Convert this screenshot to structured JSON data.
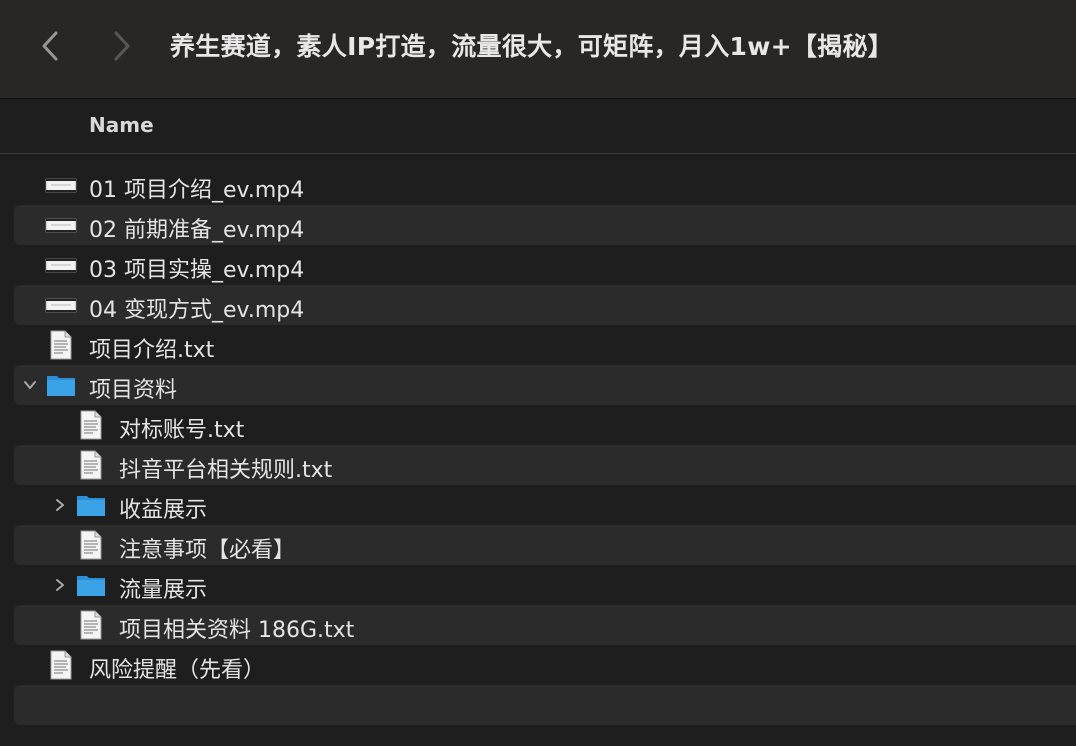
{
  "window": {
    "title": "养生赛道，素人IP打造，流量很大，可矩阵，月入1w+【揭秘】"
  },
  "header": {
    "name_column": "Name"
  },
  "files": [
    {
      "label": "01 项目介绍_ev.mp4",
      "type": "video",
      "depth": 0
    },
    {
      "label": "02 前期准备_ev.mp4",
      "type": "video",
      "depth": 0
    },
    {
      "label": "03 项目实操_ev.mp4",
      "type": "video",
      "depth": 0
    },
    {
      "label": "04 变现方式_ev.mp4",
      "type": "video",
      "depth": 0
    },
    {
      "label": "项目介绍.txt",
      "type": "text",
      "depth": 0
    },
    {
      "label": "项目资料",
      "type": "folder",
      "depth": 0,
      "expanded": true
    },
    {
      "label": "对标账号.txt",
      "type": "text",
      "depth": 1
    },
    {
      "label": "抖音平台相关规则.txt",
      "type": "text",
      "depth": 1
    },
    {
      "label": "收益展示",
      "type": "folder",
      "depth": 1,
      "expanded": false
    },
    {
      "label": "注意事项【必看】",
      "type": "text",
      "depth": 1
    },
    {
      "label": "流量展示",
      "type": "folder",
      "depth": 1,
      "expanded": false
    },
    {
      "label": "项目相关资料 186G.txt",
      "type": "text",
      "depth": 1
    },
    {
      "label": "风险提醒（先看）",
      "type": "text",
      "depth": 0
    }
  ],
  "colors": {
    "titlebar": "#2b2626",
    "background": "#1e1e1e",
    "alt_row": "#2b2b2b",
    "folder_blue": "#3aa3e8"
  },
  "icons": {
    "back": "chevron-left-icon",
    "forward": "chevron-right-icon",
    "video": "video-thumbnail-icon",
    "text": "text-document-icon",
    "folder": "folder-icon",
    "disclosure_open": "chevron-down-icon",
    "disclosure_closed": "chevron-right-icon"
  }
}
